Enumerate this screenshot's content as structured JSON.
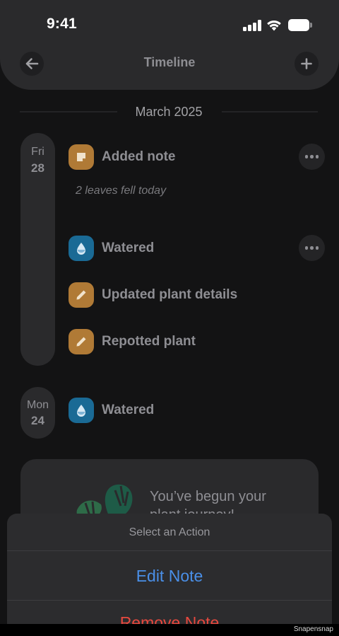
{
  "status_bar": {
    "time": "9:41"
  },
  "header": {
    "title": "Timeline",
    "back_icon": "arrow-left-icon",
    "add_icon": "plus-icon"
  },
  "month_label": "March 2025",
  "days": [
    {
      "dow": "Fri",
      "date": "28"
    },
    {
      "dow": "Mon",
      "date": "24"
    }
  ],
  "events": [
    {
      "label": "Added note",
      "icon": "note-icon"
    },
    {
      "label": "Watered",
      "icon": "water-drop-icon"
    },
    {
      "label": "Updated plant details",
      "icon": "pencil-icon"
    },
    {
      "label": "Repotted plant",
      "icon": "pencil-icon"
    },
    {
      "label": "Watered",
      "icon": "water-drop-icon"
    }
  ],
  "note_text": "2 leaves fell today",
  "promo": {
    "line1": "You’ve begun your",
    "line2": "plant journey!"
  },
  "action_sheet": {
    "title": "Select an Action",
    "edit_label": "Edit Note",
    "remove_label": "Remove Note"
  },
  "watermark": "Snapensnap",
  "colors": {
    "note_accent": "#b07a36",
    "water_accent": "#1a6a95",
    "edit": "#4a8fe7",
    "remove": "#e8493f"
  }
}
